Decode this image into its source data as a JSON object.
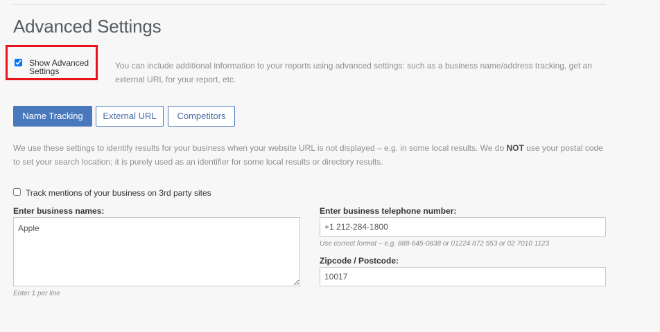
{
  "section": {
    "title": "Advanced Settings"
  },
  "advanced_toggle": {
    "label": "Show Advanced Settings",
    "checked": true,
    "highlight_color": "#e8141a",
    "description": "You can include additional information to your reports using advanced settings: such as a business name/address tracking, get an external URL for your report, etc."
  },
  "tabs": [
    {
      "label": "Name Tracking",
      "active": true
    },
    {
      "label": "External URL",
      "active": false
    },
    {
      "label": "Competitors",
      "active": false
    }
  ],
  "info": {
    "text_before": "We use these settings to identify results for your business when your website URL is not displayed – e.g. in some local results. We do ",
    "emphasis": "NOT",
    "text_after": " use your postal code to set your search location; it is purely used as an identifier for some local results or directory results."
  },
  "track_mentions": {
    "label": "Track mentions of your business on 3rd party sites",
    "checked": false
  },
  "business_names": {
    "label": "Enter business names:",
    "value": "Apple",
    "hint": "Enter 1 per line"
  },
  "telephone": {
    "label": "Enter business telephone number:",
    "value": "+1 212-284-1800",
    "hint": "Use correct format – e.g. 888-645-0838 or 01224 872 553 or 02 7010 1123"
  },
  "zipcode": {
    "label": "Zipcode / Postcode:",
    "value": "10017"
  },
  "colors": {
    "accent": "#4a78bc",
    "background": "#f7f7f7",
    "muted_text": "#8f8f8f"
  }
}
